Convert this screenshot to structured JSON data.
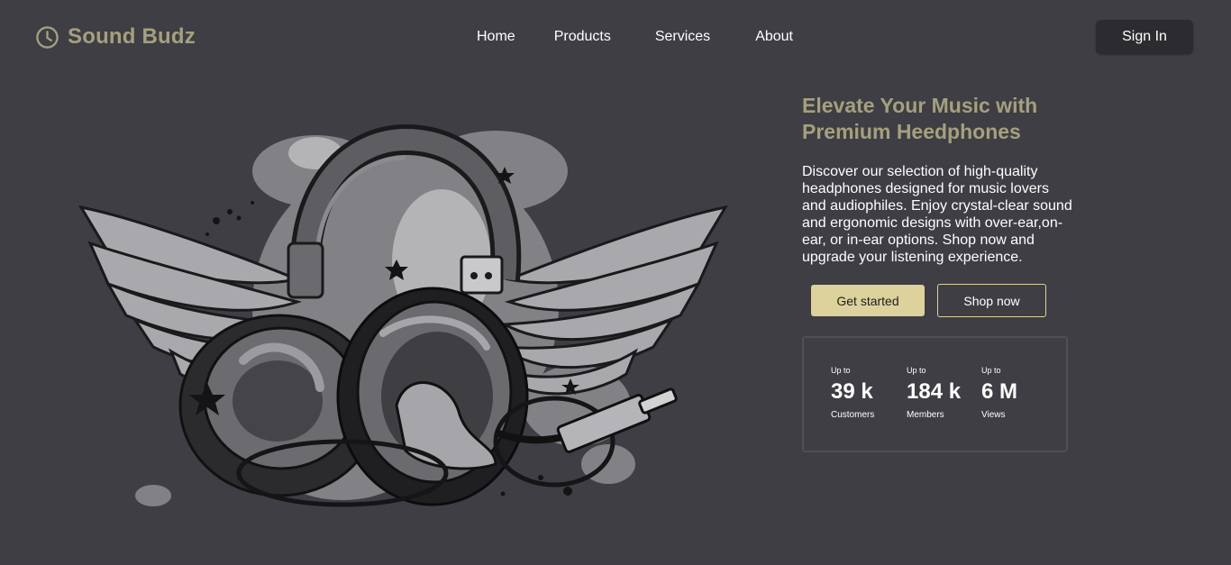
{
  "brand": {
    "name": "Sound Budz",
    "icon": "clock-icon",
    "color": "#a5a07d"
  },
  "nav": {
    "items": [
      {
        "label": "Home"
      },
      {
        "label": "Products"
      },
      {
        "label": "Services"
      },
      {
        "label": "About"
      }
    ],
    "signin_label": "Sign In"
  },
  "hero": {
    "image": "winged-headphones-illustration",
    "headline": "Elevate Your Music with Premium Heedphones",
    "description": "Discover our selection of high-quality headphones designed for music lovers and audiophiles. Enjoy crystal-clear sound and ergonomic designs with over-ear,on-ear, or in-ear options. Shop now and upgrade your listening experience.",
    "primary_button": "Get started",
    "secondary_button": "Shop now"
  },
  "stats": [
    {
      "prefix": "Up to",
      "value": "39 k",
      "label": "Customers"
    },
    {
      "prefix": "Up to",
      "value": "184 k",
      "label": "Members"
    },
    {
      "prefix": "Up to",
      "value": "6 M",
      "label": "Views"
    }
  ],
  "colors": {
    "background": "#3e3e44",
    "accent": "#a5a07d",
    "button_primary": "#ddd19c",
    "signin_bg": "#2c2c30"
  }
}
